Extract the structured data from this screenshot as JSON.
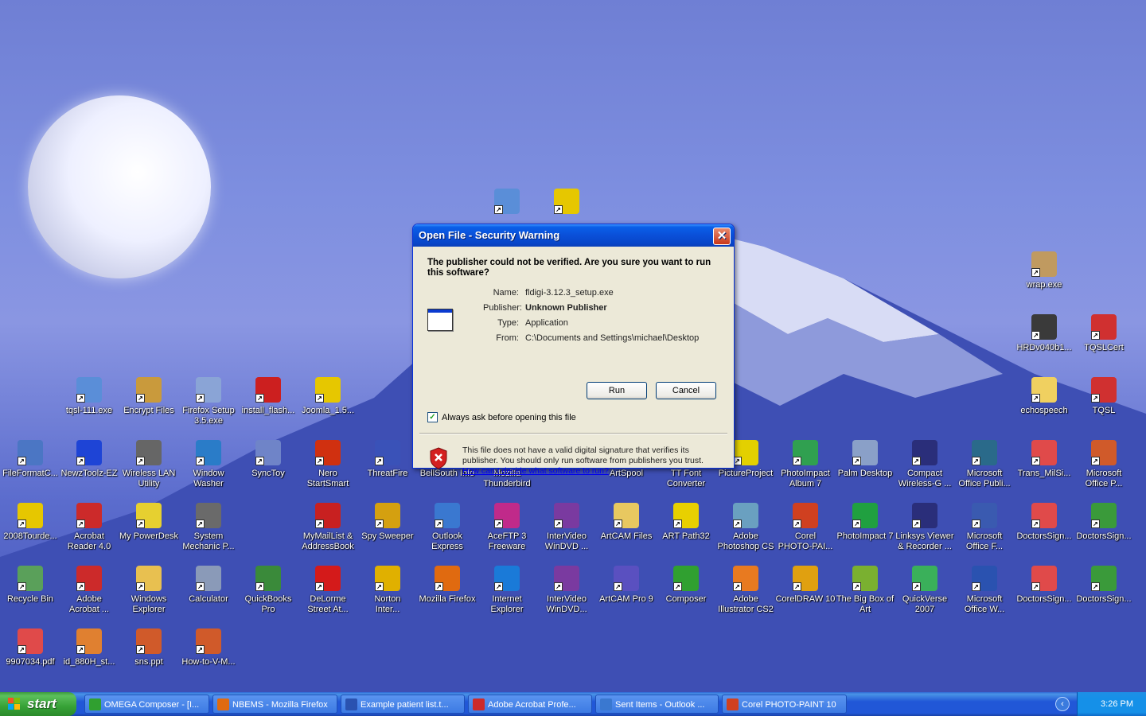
{
  "desktop": {
    "icons": [
      {
        "label": "tqsl-111.exe",
        "icon": "setup-icon",
        "color": "#5a8ed8"
      },
      {
        "label": "Encrypt Files",
        "icon": "keys-icon",
        "color": "#c99a3c"
      },
      {
        "label": "Firefox Setup\n3.5.exe",
        "icon": "cd-install-icon",
        "color": "#8aa4d6"
      },
      {
        "label": "install_flash...",
        "icon": "flash-icon",
        "color": "#cc1f1f"
      },
      {
        "label": "Joomla_1.5...",
        "icon": "zip-icon",
        "color": "#e6c700"
      },
      {
        "label": "FileFormatC...",
        "icon": "converter-icon",
        "color": "#4b76c4"
      },
      {
        "label": "NewzToolz-EZ",
        "icon": "cube-icon",
        "color": "#1e44d6"
      },
      {
        "label": "Wireless LAN\nUtility",
        "icon": "ball-icon",
        "color": "#666666"
      },
      {
        "label": "Window\nWasher",
        "icon": "washer-icon",
        "color": "#2a7cc8"
      },
      {
        "label": "SyncToy",
        "icon": "sync-icon",
        "color": "#6f84c8"
      },
      {
        "label": "Nero\nStartSmart",
        "icon": "nero-icon",
        "color": "#d03010"
      },
      {
        "label": "ThreatFire",
        "icon": "shield-icon",
        "color": "#3a52b8"
      },
      {
        "label": "BellSouth Info",
        "icon": "blank-icon",
        "color": "transparent"
      },
      {
        "label": "Mozilla\nThunderbird",
        "icon": "blank-icon",
        "color": "transparent"
      },
      {
        "label": "ArtSpool",
        "icon": "blank-icon",
        "color": "transparent"
      },
      {
        "label": "TT Font\nConverter",
        "icon": "blank-icon",
        "color": "transparent"
      },
      {
        "label": "PictureProject",
        "icon": "picture-icon",
        "color": "#e3d000"
      },
      {
        "label": "PhotoImpact\nAlbum 7",
        "icon": "album-icon",
        "color": "#30a050"
      },
      {
        "label": "Palm Desktop",
        "icon": "palm-icon",
        "color": "#8aa0c8"
      },
      {
        "label": "Compact\nWireless-G ...",
        "icon": "linksys-icon",
        "color": "#2a2e7a"
      },
      {
        "label": "Microsoft\nOffice Publi...",
        "icon": "publisher-icon",
        "color": "#2a6a8a"
      },
      {
        "label": "Trans_MilSi...",
        "icon": "pdf-icon",
        "color": "#e04a4a"
      },
      {
        "label": "Microsoft\nOffice P...",
        "icon": "powerpoint-icon",
        "color": "#d05a2a"
      },
      {
        "label": "2008Tourde...",
        "icon": "zip-icon",
        "color": "#e6c700"
      },
      {
        "label": "Acrobat\nReader 4.0",
        "icon": "acrobat-icon",
        "color": "#cc2a2a"
      },
      {
        "label": "My PowerDesk",
        "icon": "powerdesk-icon",
        "color": "#e6d030"
      },
      {
        "label": "System\nMechanic P...",
        "icon": "gear-icon",
        "color": "#6a6a6a"
      },
      {
        "label": "MyMailList &\nAddressBook",
        "icon": "mail-icon",
        "color": "#c82020"
      },
      {
        "label": "Spy Sweeper",
        "icon": "target-icon",
        "color": "#d4a010"
      },
      {
        "label": "Outlook\nExpress",
        "icon": "outlook-express-icon",
        "color": "#3a78d0"
      },
      {
        "label": "AceFTP 3\nFreeware",
        "icon": "ftp-icon",
        "color": "#c02a8a"
      },
      {
        "label": "InterVideo\nWinDVD ...",
        "icon": "dvd-icon",
        "color": "#7a3aa0"
      },
      {
        "label": "ArtCAM Files",
        "icon": "folder-icon",
        "color": "#e8c860"
      },
      {
        "label": "ART Path32",
        "icon": "artpath-icon",
        "color": "#e8d000"
      },
      {
        "label": "Adobe\nPhotoshop CS",
        "icon": "photoshop-icon",
        "color": "#6aa0c0"
      },
      {
        "label": "Corel\nPHOTO-PAI...",
        "icon": "corel-icon",
        "color": "#d04020"
      },
      {
        "label": "PhotoImpact 7",
        "icon": "photoimpact-icon",
        "color": "#20a040"
      },
      {
        "label": "Linksys Viewer\n& Recorder ...",
        "icon": "linksys-icon",
        "color": "#2a2e7a"
      },
      {
        "label": "Microsoft\nOffice F...",
        "icon": "frontpage-icon",
        "color": "#3a5ab0"
      },
      {
        "label": "DoctorsSign...",
        "icon": "pdf-icon",
        "color": "#e04a4a"
      },
      {
        "label": "DoctorsSign...",
        "icon": "media-icon",
        "color": "#3a9a3a"
      },
      {
        "label": "Recycle Bin",
        "icon": "recycle-bin-icon",
        "color": "#5aa05a"
      },
      {
        "label": "Adobe\nAcrobat ...",
        "icon": "acrobat-icon",
        "color": "#cc2a2a"
      },
      {
        "label": "Windows\nExplorer",
        "icon": "explorer-icon",
        "color": "#e8c050"
      },
      {
        "label": "Calculator",
        "icon": "calculator-icon",
        "color": "#8a9ab8"
      },
      {
        "label": "QuickBooks\nPro",
        "icon": "quickbooks-icon",
        "color": "#3a8a3a"
      },
      {
        "label": "DeLorme\nStreet At...",
        "icon": "delorme-icon",
        "color": "#d41a1a"
      },
      {
        "label": "Norton\nInter...",
        "icon": "norton-icon",
        "color": "#e0b000"
      },
      {
        "label": "Mozilla Firefox",
        "icon": "firefox-icon",
        "color": "#e06a10"
      },
      {
        "label": "Internet\nExplorer",
        "icon": "ie-icon",
        "color": "#1a7ad8"
      },
      {
        "label": "InterVideo\nWinDVD...",
        "icon": "dvd-icon",
        "color": "#7a3aa0"
      },
      {
        "label": "ArtCAM Pro 9",
        "icon": "artcam-icon",
        "color": "#5a50c0"
      },
      {
        "label": "Composer",
        "icon": "composer-icon",
        "color": "#30a030"
      },
      {
        "label": "Adobe\nIllustrator CS2",
        "icon": "illustrator-icon",
        "color": "#e87a20"
      },
      {
        "label": "CorelDRAW 10",
        "icon": "coreldraw-icon",
        "color": "#e0a010"
      },
      {
        "label": "The Big Box of\nArt",
        "icon": "bigbox-icon",
        "color": "#7ab030"
      },
      {
        "label": "QuickVerse\n2007",
        "icon": "quickverse-icon",
        "color": "#3ab05a"
      },
      {
        "label": "Microsoft\nOffice W...",
        "icon": "word-icon",
        "color": "#2a52b0"
      },
      {
        "label": "DoctorsSign...",
        "icon": "pdf-icon",
        "color": "#e04a4a"
      },
      {
        "label": "DoctorsSign...",
        "icon": "media-icon",
        "color": "#3a9a3a"
      },
      {
        "label": "9907034.pdf",
        "icon": "pdf-icon",
        "color": "#e04a4a"
      },
      {
        "label": "id_880H_st...",
        "icon": "document-icon",
        "color": "#e08030"
      },
      {
        "label": "sns.ppt",
        "icon": "powerpoint-icon",
        "color": "#d05a2a"
      },
      {
        "label": "How-to-V-M...",
        "icon": "powerpoint-icon",
        "color": "#d05a2a"
      },
      {
        "label": "wrap.exe",
        "icon": "package-icon",
        "color": "#c09a60"
      },
      {
        "label": "HRDv040b1...",
        "icon": "radio-icon",
        "color": "#3a3a3a"
      },
      {
        "label": "TQSLCert",
        "icon": "tqsl-icon",
        "color": "#d03030"
      },
      {
        "label": "echospeech",
        "icon": "folder-icon",
        "color": "#f0d060"
      },
      {
        "label": "TQSL",
        "icon": "tqsl-icon",
        "color": "#d03030"
      },
      {
        "label": "",
        "icon": "setup-icon",
        "color": "#5a8ed8"
      },
      {
        "label": "",
        "icon": "zip-icon",
        "color": "#e6c700"
      }
    ]
  },
  "dialog": {
    "title": "Open File - Security Warning",
    "question": "The publisher could not be verified.  Are you sure you want to run this software?",
    "fields": [
      {
        "key": "Name:",
        "value": "fldigi-3.12.3_setup.exe",
        "bold": false
      },
      {
        "key": "Publisher:",
        "value": "Unknown Publisher",
        "bold": true
      },
      {
        "key": "Type:",
        "value": "Application",
        "bold": false
      },
      {
        "key": "From:",
        "value": "C:\\Documents and Settings\\michael\\Desktop",
        "bold": false
      }
    ],
    "run_label": "Run",
    "cancel_label": "Cancel",
    "checkbox_label": "Always ask before opening this file",
    "checkbox_checked": true,
    "warning_text": "This file does not have a valid digital signature that verifies its publisher.  You should only run software from publishers you trust.",
    "warning_link": "How can I decide what software to run?"
  },
  "taskbar": {
    "start_label": "start",
    "tasks": [
      {
        "label": "OMEGA Composer - [I...",
        "icon": "composer-icon",
        "color": "#30a030"
      },
      {
        "label": "NBEMS - Mozilla Firefox",
        "icon": "firefox-icon",
        "color": "#e06a10"
      },
      {
        "label": "Example patient list.t...",
        "icon": "word-icon",
        "color": "#2a52b0"
      },
      {
        "label": "Adobe Acrobat Profe...",
        "icon": "acrobat-icon",
        "color": "#cc2a2a"
      },
      {
        "label": "Sent Items - Outlook ...",
        "icon": "outlook-icon",
        "color": "#3a78d0"
      },
      {
        "label": "Corel PHOTO-PAINT 10",
        "icon": "corel-icon",
        "color": "#d04020"
      }
    ],
    "clock": "3:26 PM"
  }
}
